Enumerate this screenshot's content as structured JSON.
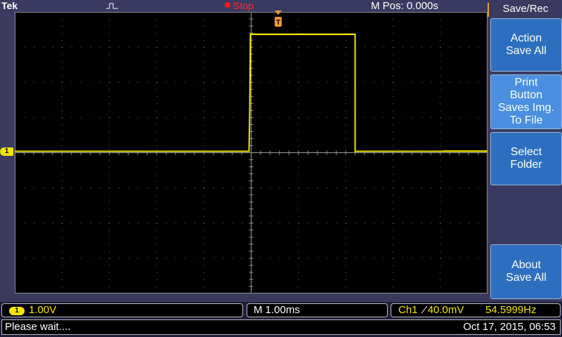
{
  "header": {
    "brand": "Tek",
    "trigger_icon": "pulse-waveform-icon",
    "acq_state": "Stop",
    "m_pos": "M Pos: 0.000s"
  },
  "channel_marker": "1",
  "trace_color": "#f2e600",
  "menu": {
    "title": "Save/Rec",
    "buttons": [
      {
        "label": "Action\nSave All"
      },
      {
        "label": "Print\nButton\nSaves Img.\nTo File"
      },
      {
        "label": "Select\nFolder"
      },
      {
        "label": "About\nSave All"
      }
    ]
  },
  "readouts": {
    "ch_badge": "1",
    "ch_scale": "1.00V",
    "timebase": "M 1.00ms",
    "trigger_source": "Ch1",
    "trigger_slope_icon": "rising-edge-icon",
    "trigger_level": "40.0mV",
    "frequency": "54.5999Hz"
  },
  "status": {
    "message": "Please wait....",
    "datetime": "Oct 17, 2015, 06:53"
  }
}
